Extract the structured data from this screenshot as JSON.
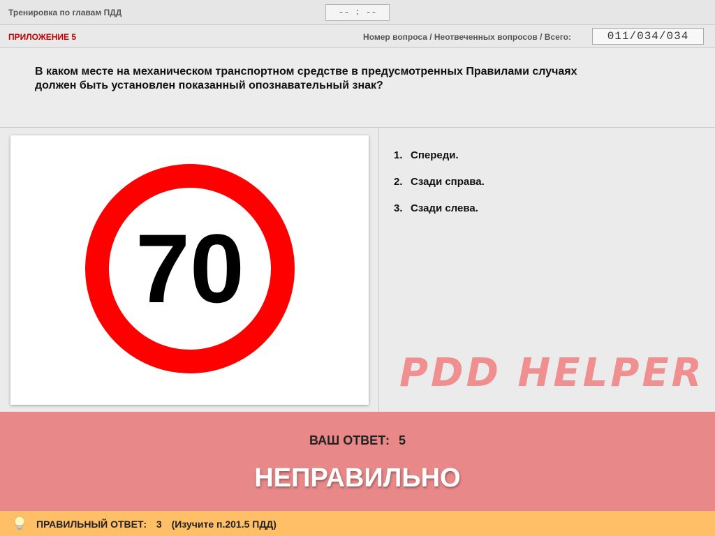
{
  "header": {
    "title": "Тренировка по главам ПДД",
    "timer": "-- : --"
  },
  "infobar": {
    "appendix": "ПРИЛОЖЕНИЕ 5",
    "counter_label": "Номер вопроса / Неотвеченных вопросов / Всего:",
    "counter_value": "011/034/034"
  },
  "question": {
    "text_line1": "В каком месте на механическом транспортном средстве в предусмотренных Правилами случаях",
    "text_line2": "должен быть установлен показанный опознавательный знак?"
  },
  "image": {
    "sign_number": "70",
    "sign_ring_color": "#ff0000"
  },
  "answers": [
    {
      "num": "1.",
      "label": "Спереди."
    },
    {
      "num": "2.",
      "label": "Сзади справа."
    },
    {
      "num": "3.",
      "label": "Сзади слева."
    }
  ],
  "watermark": "PDD HELPER",
  "result": {
    "your_answer_label": "ВАШ  ОТВЕТ:",
    "your_answer_value": "5",
    "verdict": "НЕПРАВИЛЬНО",
    "background_color": "#e88888"
  },
  "correct": {
    "label": "ПРАВИЛЬНЫЙ ОТВЕТ:",
    "value": "3",
    "hint": "(Изучите п.201.5 ПДД)",
    "icon": "lightbulb-icon",
    "background_color": "#ffbf66"
  }
}
